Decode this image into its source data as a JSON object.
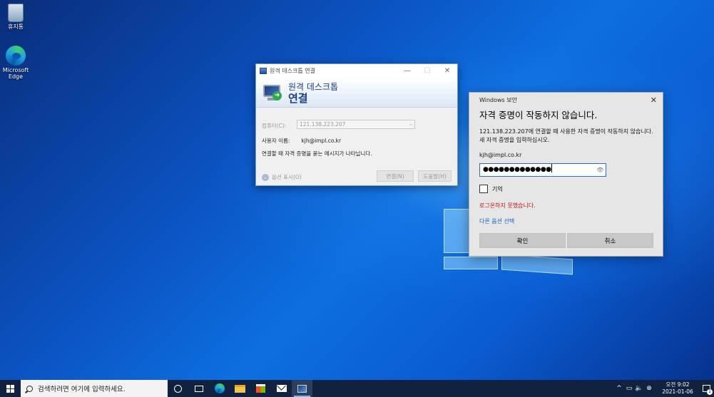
{
  "desktop": {
    "icons": [
      {
        "label": "휴지통"
      },
      {
        "label": "Microsoft Edge"
      }
    ]
  },
  "rdp_window": {
    "title": "원격 데스크톱 연결",
    "banner_line1": "원격 데스크톱",
    "banner_line2": "연결",
    "computer_label": "컴퓨터(C):",
    "computer_value": "121.138.223.207",
    "user_label": "사용자 이름:",
    "user_value": "kjh@impl.co.kr",
    "info_text": "연결할 때 자격 증명을 묻는 메시지가 나타납니다.",
    "options_label": "옵션 표시(O)",
    "connect_button": "연결(N)",
    "help_button": "도움말(H)",
    "minimize": "—",
    "maximize": "☐",
    "close": "✕"
  },
  "security_dialog": {
    "window_title": "Windows 보안",
    "close": "✕",
    "heading": "자격 증명이 작동하지 않습니다.",
    "message": "121.138.223.207에 연결할 때 사용한 자격 증명이 작동하지 않습니다. 새 자격 증명을 입력하십시오.",
    "username": "kjh@impl.co.kr",
    "password_mask": "●●●●●●●●●●●●●",
    "remember_label": "기억",
    "remember_checked": false,
    "error_text": "로그온하지 못했습니다.",
    "more_choices_link": "다른 옵션 선택",
    "ok_button": "확인",
    "cancel_button": "취소"
  },
  "taskbar": {
    "search_placeholder": "검색하려면 여기에 입력하세요.",
    "tray_chevron": "^",
    "clock_time": "오전 9:02",
    "clock_date": "2021-01-06",
    "notification_count": "1"
  }
}
